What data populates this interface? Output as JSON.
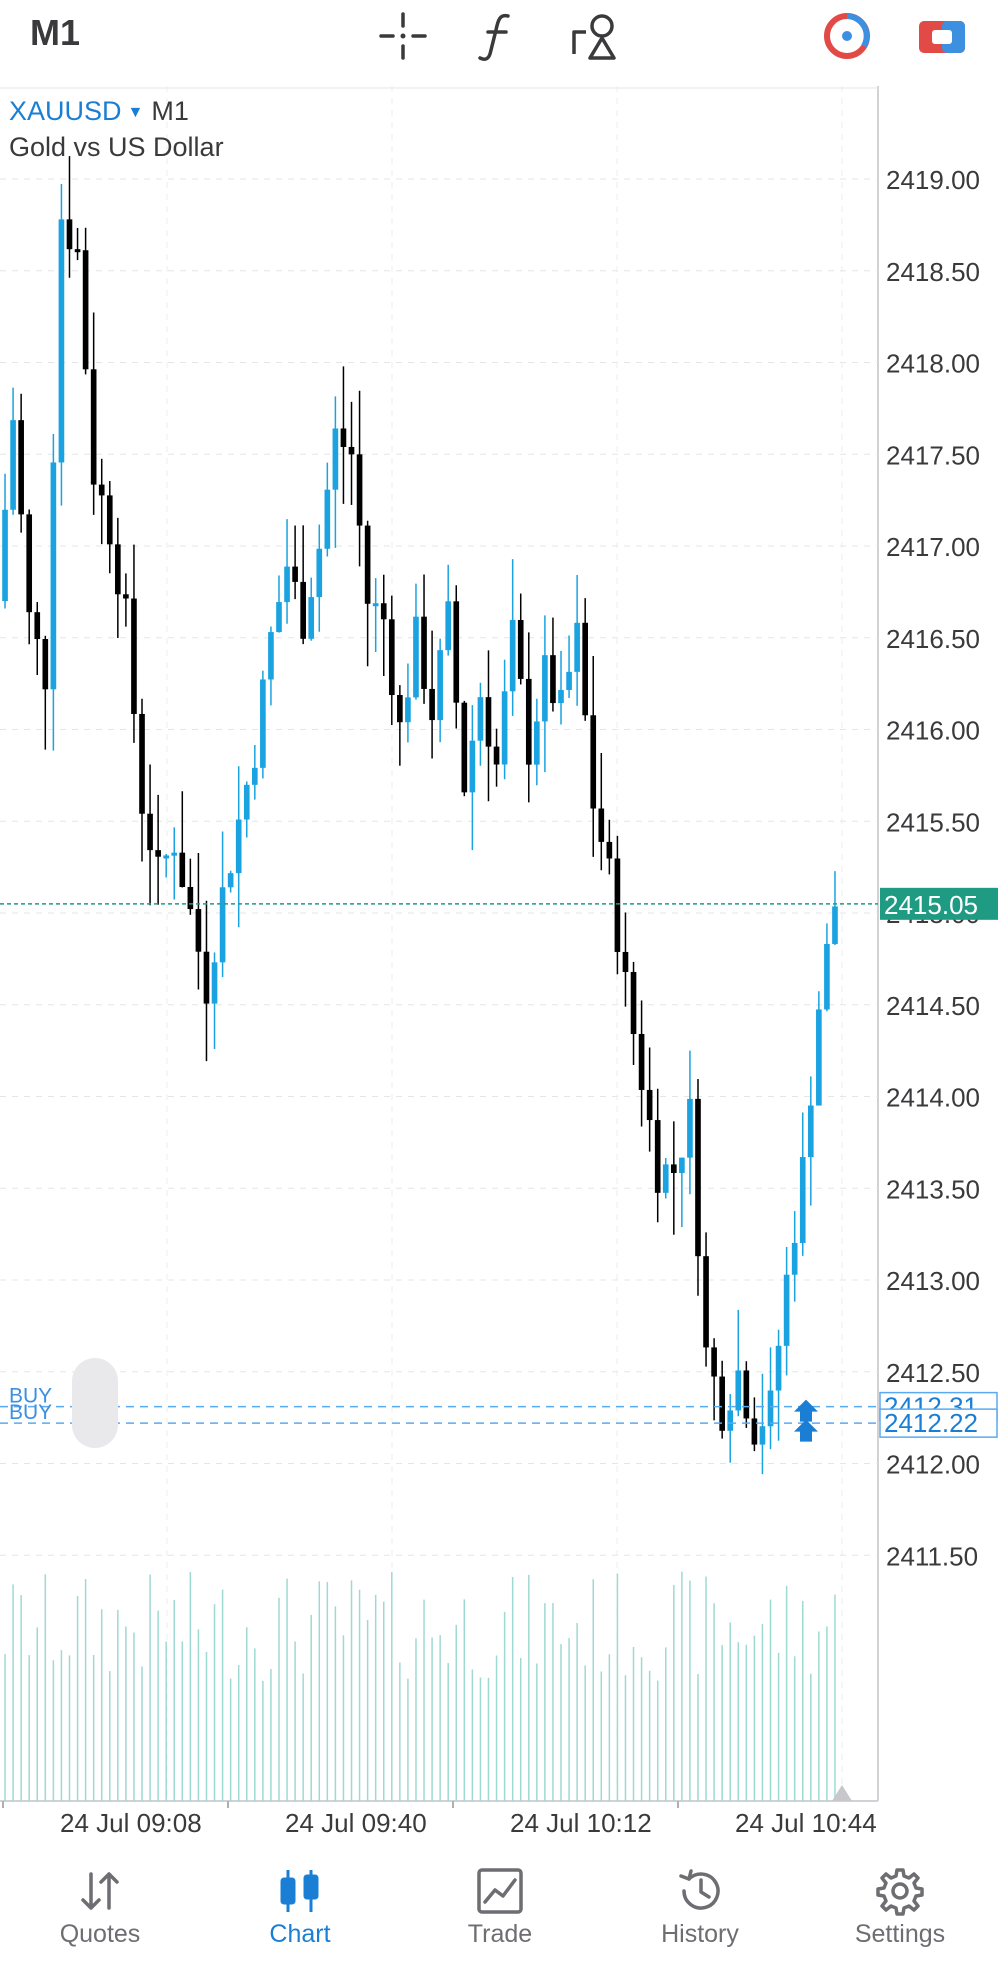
{
  "header": {
    "timeframe": "M1",
    "icons": [
      "crosshair-icon",
      "function-icon",
      "objects-icon",
      "one-click-trading-icon",
      "trade-panel-icon"
    ]
  },
  "chart": {
    "symbol": "XAUUSD",
    "timeframe": "M1",
    "description": "Gold vs US Dollar",
    "current_price": "2415.05",
    "buy_label": "BUY",
    "colors": {
      "bull": "#1aa3e0",
      "bear": "#000000",
      "price_line": "#1f9b84",
      "order_line": "#5aa9f2",
      "volume": "#9fd9d3"
    }
  },
  "chart_data": {
    "type": "candlestick",
    "symbol": "XAUUSD",
    "timeframe": "M1",
    "ylim": [
      2411.5,
      2419.0
    ],
    "y_ticks": [
      "2419.00",
      "2418.50",
      "2418.00",
      "2417.50",
      "2417.00",
      "2416.50",
      "2416.00",
      "2415.50",
      "2415.00",
      "2414.50",
      "2414.00",
      "2413.50",
      "2413.00",
      "2412.50",
      "2412.00",
      "2411.50"
    ],
    "x_ticks": [
      "24 Jul 09:08",
      "24 Jul 09:40",
      "24 Jul 10:12",
      "24 Jul 10:44"
    ],
    "current_price": 2415.05,
    "orders": [
      {
        "type": "BUY",
        "price": 2412.31
      },
      {
        "type": "BUY",
        "price": 2412.22
      }
    ],
    "close_path": [
      2416.7,
      2417.7,
      2416.6,
      2416.3,
      2418.8,
      2418.6,
      2417.4,
      2417.1,
      2416.6,
      2415.6,
      2415.2,
      2415.4,
      2415.0,
      2414.6,
      2415.1,
      2415.5,
      2415.9,
      2416.5,
      2416.9,
      2416.6,
      2417.0,
      2417.6,
      2417.5,
      2416.7,
      2416.6,
      2416.0,
      2416.5,
      2416.1,
      2416.6,
      2415.7,
      2416.2,
      2415.8,
      2416.5,
      2415.9,
      2416.3,
      2416.1,
      2416.5,
      2415.6,
      2415.2,
      2414.6,
      2414.1,
      2413.6,
      2413.6,
      2413.9,
      2412.6,
      2412.3,
      2412.5,
      2412.2,
      2412.3,
      2413.0,
      2413.6,
      2414.5,
      2415.05
    ]
  },
  "tabs": [
    {
      "label": "Quotes"
    },
    {
      "label": "Chart"
    },
    {
      "label": "Trade"
    },
    {
      "label": "History"
    },
    {
      "label": "Settings"
    }
  ]
}
